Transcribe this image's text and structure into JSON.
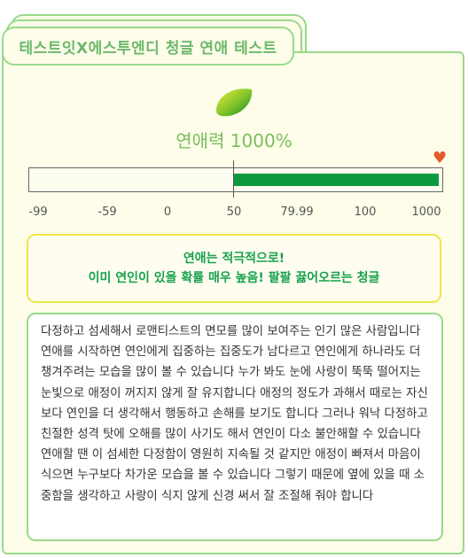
{
  "header": {
    "title": "테스트잇X에스투엔디 청글 연애 테스트"
  },
  "result": {
    "score_label": "연애력 1000%",
    "level_fraction": 0.5,
    "level_value": 1000
  },
  "gauge": {
    "ticks": [
      "-99",
      "-59",
      "0",
      "50",
      "79.99",
      "100",
      "1000"
    ]
  },
  "summary": {
    "line1": "연애는 적극적으로!",
    "line2": "이미 연인이 있을 확률 매우 높음! 팔팔 끓어오르는 청글"
  },
  "description": "다정하고 섬세해서 로맨티스트의 면모를 많이 보여주는 인기 많은 사람입니다 연애를 시작하면 연인에게 집중하는 집중도가 남다르고 연인에게 하나라도 더 챙겨주려는 모습을 많이 볼 수 있습니다 누가 봐도 눈에 사랑이 뚝뚝 떨어지는 눈빛으로 애정이 꺼지지 않게 잘 유지합니다 애정의 정도가 과해서 때로는 자신보다 연인을 더 생각해서 행동하고 손해를 보기도 합니다 그러나 워낙 다정하고 친절한 성격 탓에 오해를 많이 사기도 해서 연인이 다소 불안해할 수 있습니다 연애할 땐 이 섬세한 다정함이 영원히 지속될 것 같지만 애정이 빠져서 마음이 식으면 누구보다 차가운 모습을 볼 수 있습니다 그렇기 때문에 옆에 있을 때 소중함을 생각하고 사랑이 식지 않게 신경 써서 잘 조절해 줘야 합니다",
  "colors": {
    "accent": "#0d9a3f",
    "border": "#9ad98a",
    "summary_border": "#f0e64a",
    "heart": "#e25a2c"
  },
  "icons": {
    "badge": "leaf-icon",
    "marker": "heart-icon"
  }
}
